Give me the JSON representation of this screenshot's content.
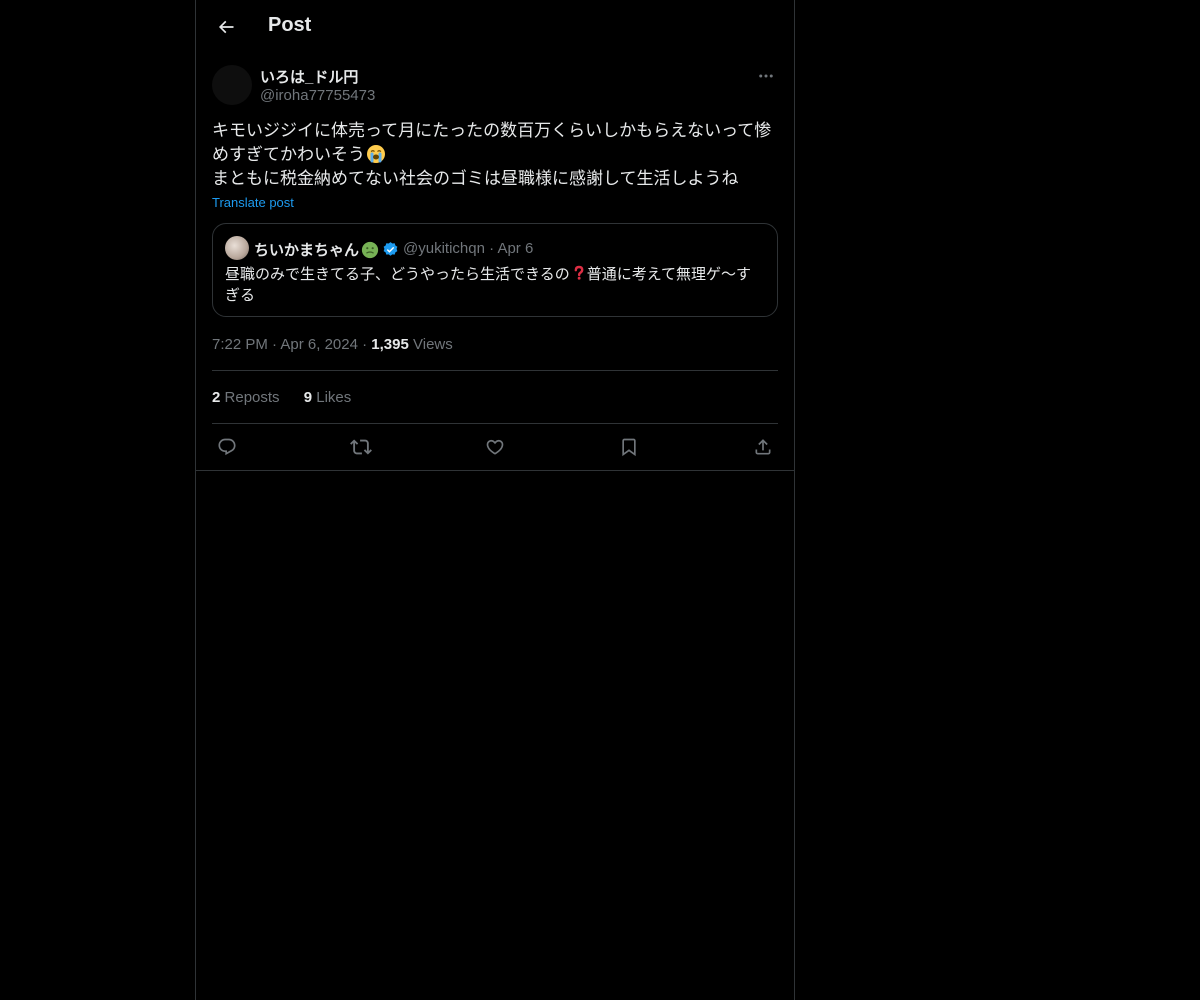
{
  "header": {
    "title": "Post",
    "back_icon": "arrow-left-icon"
  },
  "post": {
    "author": {
      "display_name": "いろは_ドル円",
      "handle": "@iroha77755473"
    },
    "text_lines": [
      "キモいジジイに体売って月にたったの数百万くらいしかもらえないって惨",
      "めすぎてかわいそう",
      "まともに税金納めてない社会のゴミは昼職様に感謝して生活しようね"
    ],
    "text_emoji": "loudly-crying-face",
    "translate_label": "Translate post",
    "quote": {
      "display_name": "ちいかまちゃん",
      "name_emoji": "nauseated-face",
      "verified": true,
      "handle": "@yukitichqn",
      "separator": "·",
      "date": "Apr 6",
      "text_before": "昼職のみで生きてる子、どうやったら生活できるの",
      "text_emoji": "red-question-mark",
      "text_after": "普通に考えて無理ゲ〜すぎる"
    },
    "meta": {
      "time": "7:22 PM",
      "separator": "·",
      "date": "Apr 6, 2024",
      "views_count": "1,395",
      "views_label": "Views"
    },
    "stats": {
      "reposts_count": "2",
      "reposts_label": "Reposts",
      "likes_count": "9",
      "likes_label": "Likes"
    }
  },
  "actions": [
    "reply-icon",
    "repost-icon",
    "like-icon",
    "bookmark-icon",
    "share-icon"
  ],
  "colors": {
    "background": "#000000",
    "text": "#e7e9ea",
    "secondary": "#71767b",
    "accent": "#1d9bf0",
    "border": "#2f3336"
  }
}
